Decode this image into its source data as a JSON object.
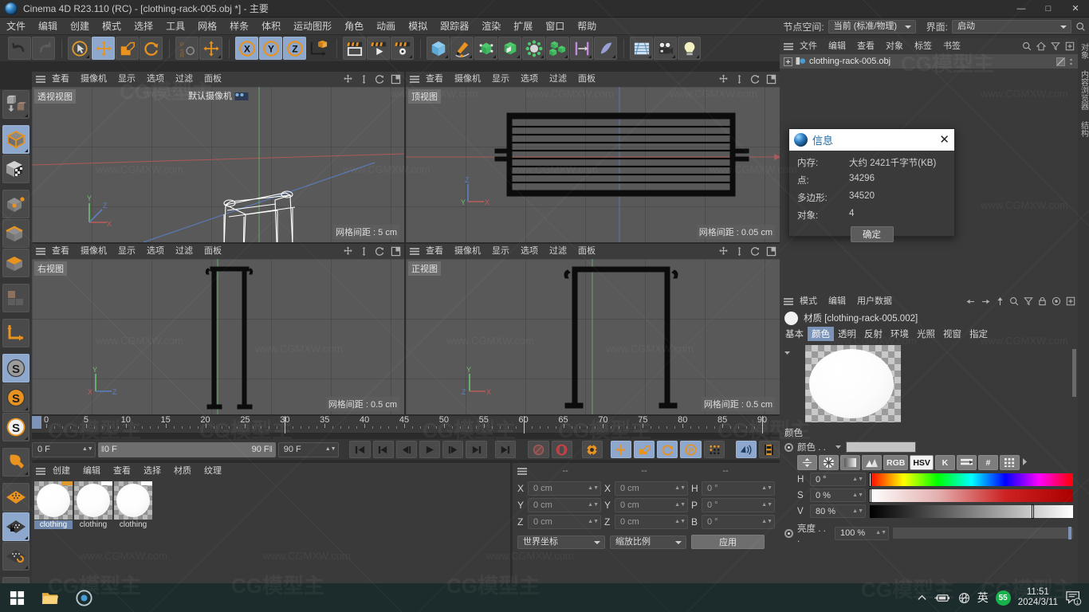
{
  "window": {
    "title": "Cinema 4D R23.110 (RC) - [clothing-rack-005.obj *] - 主要",
    "app_icon": "cinema4d-logo-icon",
    "minimize": "—",
    "maximize": "□",
    "close": "✕"
  },
  "menubar": {
    "items": [
      "文件",
      "编辑",
      "创建",
      "模式",
      "选择",
      "工具",
      "网格",
      "样条",
      "体积",
      "运动图形",
      "角色",
      "动画",
      "模拟",
      "跟踪器",
      "渲染",
      "扩展",
      "窗口",
      "帮助"
    ],
    "node_space_label": "节点空间:",
    "node_space_value": "当前 (标准/物理)",
    "interface_label": "界面:",
    "interface_value": "启动"
  },
  "object_manager": {
    "menu": [
      "文件",
      "编辑",
      "查看",
      "对象",
      "标签",
      "书签"
    ],
    "icons": [
      "search-icon",
      "home-icon",
      "filter-icon",
      "add-icon"
    ],
    "rows": [
      {
        "name": "clothing-rack-005.obj"
      }
    ]
  },
  "info_dialog": {
    "title": "信息",
    "rows": [
      {
        "key": "内存:",
        "value": "大约 2421千字节(KB)"
      },
      {
        "key": "点:",
        "value": "34296"
      },
      {
        "key": "多边形:",
        "value": "34520"
      },
      {
        "key": "对象:",
        "value": "4"
      }
    ],
    "ok": "确定",
    "close": "✕"
  },
  "attribute_manager": {
    "menu": [
      "模式",
      "编辑",
      "用户数据"
    ],
    "material_label": "材质 [clothing-rack-005.002]",
    "tabs": [
      "基本",
      "颜色",
      "透明",
      "反射",
      "环境",
      "光照",
      "视窗",
      "指定"
    ],
    "active_tab": "颜色",
    "section_title": "颜色",
    "color_row_label": "颜色 . .",
    "color_swatch": "#c3c3c3",
    "color_mode_buttons": [
      "sliders-icon",
      "wheel-icon",
      "gradient-icon",
      "mixer-icon",
      "RGB",
      "HSV",
      "K",
      "spectrum-icon",
      "#",
      "table-icon"
    ],
    "active_color_mode": "HSV",
    "hsv": [
      {
        "key": "H",
        "value": "0 °",
        "pos": 0
      },
      {
        "key": "S",
        "value": "0 %",
        "pos": 0
      },
      {
        "key": "V",
        "value": "80 %",
        "pos": 80
      }
    ],
    "brightness_label": "亮度 . . .",
    "brightness_value": "100 %"
  },
  "viewports": [
    {
      "name": "透视视图",
      "menu": [
        "查看",
        "摄像机",
        "显示",
        "选项",
        "过滤",
        "面板"
      ],
      "grid": "网格间距 : 5 cm",
      "grid_side": "left",
      "camera": "默认摄像机"
    },
    {
      "name": "顶视图",
      "menu": [
        "查看",
        "摄像机",
        "显示",
        "选项",
        "过滤",
        "面板"
      ],
      "grid": "网格间距 : 0.05 cm",
      "grid_side": "right",
      "camera": ""
    },
    {
      "name": "右视图",
      "menu": [
        "查看",
        "摄像机",
        "显示",
        "选项",
        "过滤",
        "面板"
      ],
      "grid": "网格间距 : 0.5 cm",
      "grid_side": "right",
      "camera": ""
    },
    {
      "name": "正视图",
      "menu": [
        "查看",
        "摄像机",
        "显示",
        "选项",
        "过滤",
        "面板"
      ],
      "grid": "网格间距 : 0.5 cm",
      "grid_side": "right",
      "camera": ""
    }
  ],
  "timeline": {
    "ticks": [
      0,
      5,
      10,
      15,
      20,
      25,
      30,
      35,
      40,
      45,
      50,
      55,
      60,
      65,
      70,
      75,
      80,
      85,
      90
    ],
    "min": 0,
    "max": 90,
    "playhead": 0,
    "current_frame": "0 F",
    "range_start": "0 F",
    "range_end": "90 F",
    "end_frame": "90 F",
    "preview_frame": "0 F"
  },
  "material_manager": {
    "menu": [
      "创建",
      "编辑",
      "查看",
      "选择",
      "材质",
      "纹理"
    ],
    "materials": [
      {
        "name": "clothing",
        "selected": true
      },
      {
        "name": "clothing",
        "selected": false
      },
      {
        "name": "clothing",
        "selected": false
      }
    ]
  },
  "coordinates": {
    "headers": [
      "--",
      "--",
      "--"
    ],
    "rows": [
      {
        "a1": "X",
        "v1": "0 cm",
        "a2": "X",
        "v2": "0 cm",
        "a3": "H",
        "v3": "0 °"
      },
      {
        "a1": "Y",
        "v1": "0 cm",
        "a2": "Y",
        "v2": "0 cm",
        "a3": "P",
        "v3": "0 °"
      },
      {
        "a1": "Z",
        "v1": "0 cm",
        "a2": "Z",
        "v2": "0 cm",
        "a3": "B",
        "v3": "0 °"
      }
    ],
    "system": "世界坐标",
    "scale_mode": "缩放比例",
    "apply": "应用"
  },
  "right_strip": [
    "对象",
    "内容浏览器",
    "结构"
  ],
  "taskbar": {
    "start": "windows-start-icon",
    "apps": [
      "file-explorer-icon",
      "browser-icon"
    ],
    "tray": [
      "chevron-up-icon",
      "battery-icon",
      "network-icon"
    ],
    "ime": "英",
    "badge": "55",
    "time": "11:51",
    "date": "2024/3/11",
    "notification": "notification-icon"
  },
  "watermarks": [
    "www.CGMXW.com",
    "CG模型主"
  ]
}
